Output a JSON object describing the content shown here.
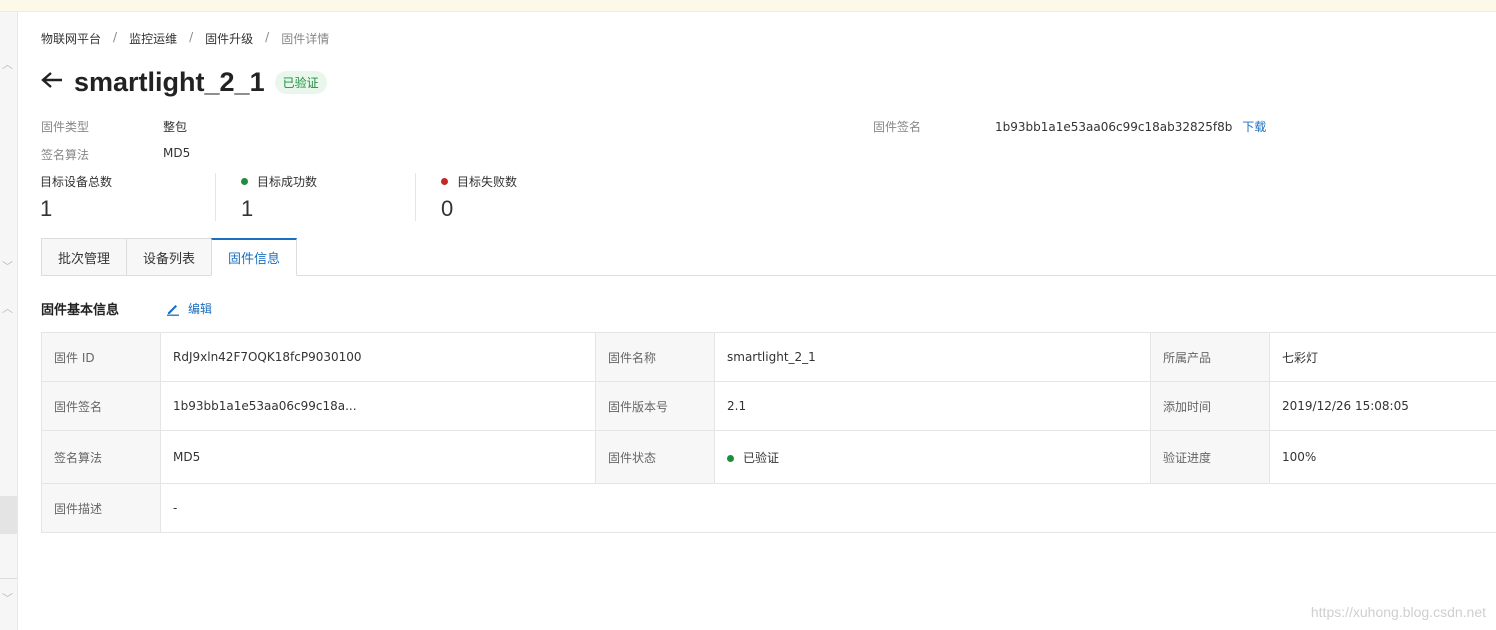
{
  "breadcrumb": [
    "物联网平台",
    "监控运维",
    "固件升级",
    "固件详情"
  ],
  "breadcrumb_sep": "/",
  "title": "smartlight_2_1",
  "status_badge": "已验证",
  "meta": {
    "type_label": "固件类型",
    "type_value": "整包",
    "algo_label": "签名算法",
    "algo_value": "MD5",
    "sign_label": "固件签名",
    "sign_value": "1b93bb1a1e53aa06c99c18ab32825f8b",
    "download": "下载"
  },
  "stats": [
    {
      "label": "目标设备总数",
      "value": "1"
    },
    {
      "label": "目标成功数",
      "value": "1",
      "color": "#1e8e3e"
    },
    {
      "label": "目标失败数",
      "value": "0",
      "color": "#c62828"
    }
  ],
  "tabs": [
    "批次管理",
    "设备列表",
    "固件信息"
  ],
  "active_tab": 2,
  "section": {
    "title": "固件基本信息",
    "edit": "编辑"
  },
  "info": {
    "r1": {
      "k1": "固件 ID",
      "v1": "RdJ9xln42F7OQK18fcP9030100",
      "k2": "固件名称",
      "v2": "smartlight_2_1",
      "k3": "所属产品",
      "v3": "七彩灯"
    },
    "r2": {
      "k1": "固件签名",
      "v1": "1b93bb1a1e53aa06c99c18a...",
      "k2": "固件版本号",
      "v2": "2.1",
      "k3": "添加时间",
      "v3": "2019/12/26 15:08:05"
    },
    "r3": {
      "k1": "签名算法",
      "v1": "MD5",
      "k2": "固件状态",
      "v2": "已验证",
      "k3": "验证进度",
      "v3": "100%"
    },
    "r4": {
      "k1": "固件描述",
      "v1": "-"
    }
  },
  "watermark": "https://xuhong.blog.csdn.net",
  "colors": {
    "accent": "#1a6fc2",
    "success": "#1e8e3e",
    "danger": "#c62828"
  }
}
